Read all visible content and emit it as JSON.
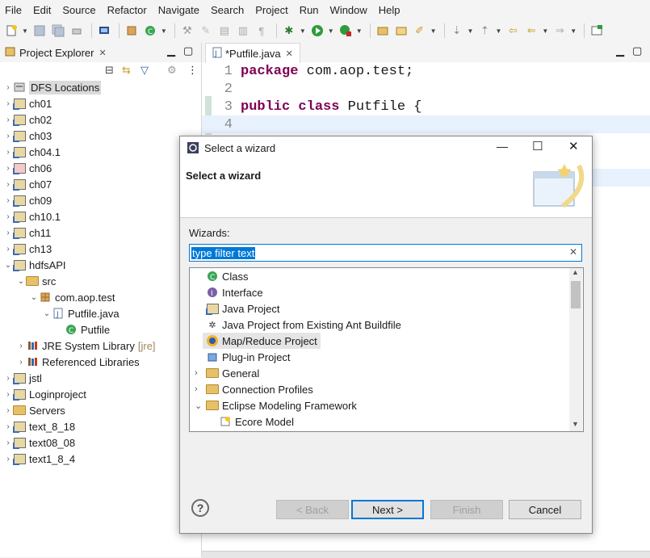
{
  "menu": [
    "File",
    "Edit",
    "Source",
    "Refactor",
    "Navigate",
    "Search",
    "Project",
    "Run",
    "Window",
    "Help"
  ],
  "explorer": {
    "tab_label": "Project Explorer",
    "tab_close": "✕",
    "items": [
      {
        "label": "DFS Locations",
        "suffix": ""
      },
      {
        "label": "ch01",
        "suffix": ""
      },
      {
        "label": "ch02",
        "suffix": ""
      },
      {
        "label": "ch03",
        "suffix": ""
      },
      {
        "label": "ch04.1",
        "suffix": ""
      },
      {
        "label": "ch06",
        "suffix": ""
      },
      {
        "label": "ch07",
        "suffix": ""
      },
      {
        "label": "ch09",
        "suffix": ""
      },
      {
        "label": "ch10.1",
        "suffix": ""
      },
      {
        "label": "ch11",
        "suffix": ""
      },
      {
        "label": "ch13",
        "suffix": ""
      },
      {
        "label": "hdfsAPI",
        "suffix": ""
      },
      {
        "label": "src",
        "suffix": ""
      },
      {
        "label": "com.aop.test",
        "suffix": ""
      },
      {
        "label": "Putfile.java",
        "suffix": ""
      },
      {
        "label": "Putfile",
        "suffix": ""
      },
      {
        "label": "JRE System Library",
        "suffix": "[jre]"
      },
      {
        "label": "Referenced Libraries",
        "suffix": ""
      },
      {
        "label": "jstl",
        "suffix": ""
      },
      {
        "label": "Loginproject",
        "suffix": ""
      },
      {
        "label": "Servers",
        "suffix": ""
      },
      {
        "label": "text_8_18",
        "suffix": ""
      },
      {
        "label": "text08_08",
        "suffix": ""
      },
      {
        "label": "text1_8_4",
        "suffix": ""
      }
    ]
  },
  "editor": {
    "tab_label": "*Putfile.java",
    "tab_close": "✕",
    "lines": [
      {
        "num": "1",
        "kw": "package",
        "rest": " com.aop.test;"
      },
      {
        "num": "2",
        "kw": "",
        "rest": ""
      },
      {
        "num": "3",
        "kw": "public class",
        "rest": " Putfile {"
      },
      {
        "num": "4",
        "kw": "",
        "rest": ""
      }
    ]
  },
  "dialog": {
    "window_title": "Select a wizard",
    "header_title": "Select a wizard",
    "wizards_label": "Wizards:",
    "filter_placeholder": "type filter text",
    "filter_clear": "✕",
    "items": [
      {
        "label": "Class"
      },
      {
        "label": "Interface"
      },
      {
        "label": "Java Project"
      },
      {
        "label": "Java Project from Existing Ant Buildfile"
      },
      {
        "label": "Map/Reduce Project"
      },
      {
        "label": "Plug-in Project"
      },
      {
        "label": "General"
      },
      {
        "label": "Connection Profiles"
      },
      {
        "label": "Eclipse Modeling Framework"
      },
      {
        "label": "Ecore Model"
      }
    ],
    "help": "?",
    "back_label": "< Back",
    "next_label": "Next >",
    "finish_label": "Finish",
    "cancel_label": "Cancel"
  },
  "colors": {
    "keyword": "#7f0055",
    "selection": "#0078d7",
    "list_highlight": "#dadada"
  }
}
